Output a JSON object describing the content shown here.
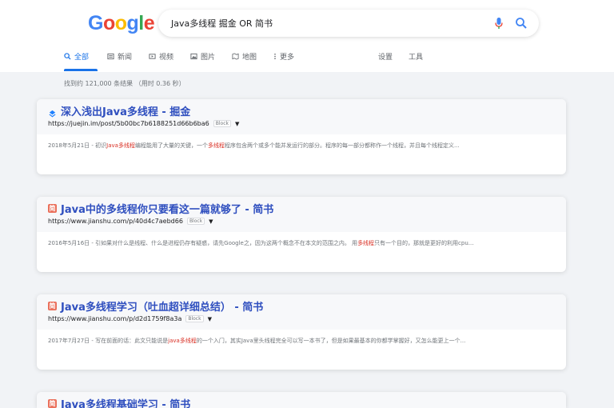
{
  "header": {
    "logo": {
      "g1": "G",
      "o1": "o",
      "o2": "o",
      "g2": "g",
      "l": "l",
      "e": "e"
    },
    "query": "Java多线程 掘金 OR 简书",
    "icons": {
      "mic": "mic-icon",
      "search": "search-icon"
    }
  },
  "tabs": [
    {
      "label": "全部",
      "icon": "search-icon",
      "active": true
    },
    {
      "label": "新闻",
      "icon": "news-icon"
    },
    {
      "label": "视频",
      "icon": "video-icon"
    },
    {
      "label": "图片",
      "icon": "image-icon"
    },
    {
      "label": "地图",
      "icon": "map-icon"
    },
    {
      "label": "更多",
      "icon": "more-icon"
    },
    {
      "label": "设置"
    },
    {
      "label": "工具"
    }
  ],
  "stats": "找到约 121,000 条结果 （用时 0.36 秒）",
  "results": [
    {
      "title": "深入浅出Java多线程 - 掘金",
      "url": "https://juejin.im/post/5b00bc7b6188251d66b6ba6",
      "cache": "Block",
      "snippet_pre": "2018年5月21日 - 初识",
      "snippet_hl1": "Java多线程",
      "snippet_mid": "编程能用了大量的关键，一个",
      "snippet_hl2": "多线程",
      "snippet_post": "程序包含两个或多个能并发运行的部分。程序的每一部分都称作一个线程，并且每个线程定义..."
    },
    {
      "title": "Java中的多线程你只要看这一篇就够了 - 简书",
      "url": "https://www.jianshu.com/p/40d4c7aebd66",
      "cache": "Block",
      "snippet_pre": "2016年5月16日 - 引如果对什么是线程、什么是进程仍存有疑惑，请先Google之，因为这两个概念不在本文的范围之内。 用",
      "snippet_hl1": "多线程",
      "snippet_mid": "只有一个目的，那就是更好的利用cpu",
      "snippet_hl2": "",
      "snippet_post": "..."
    },
    {
      "title": "Java多线程学习（吐血超详细总结） - 简书",
      "url": "https://www.jianshu.com/p/d2d1759f8a3a",
      "cache": "Block",
      "snippet_pre": "2017年7月27日 - 写在前面的话：此文只能说是",
      "snippet_hl1": "java多线程",
      "snippet_mid": "的一个入门，其实Java里头线程完全可以写一本书了，但是如果最基本的你都学掌握好，又怎么能更上一个",
      "snippet_hl2": "",
      "snippet_post": "..."
    },
    {
      "title": "Java多线程基础学习 - 简书",
      "url": "",
      "cache": "",
      "snippet_pre": "",
      "snippet_hl1": "",
      "snippet_mid": "",
      "snippet_hl2": "",
      "snippet_post": ""
    }
  ]
}
